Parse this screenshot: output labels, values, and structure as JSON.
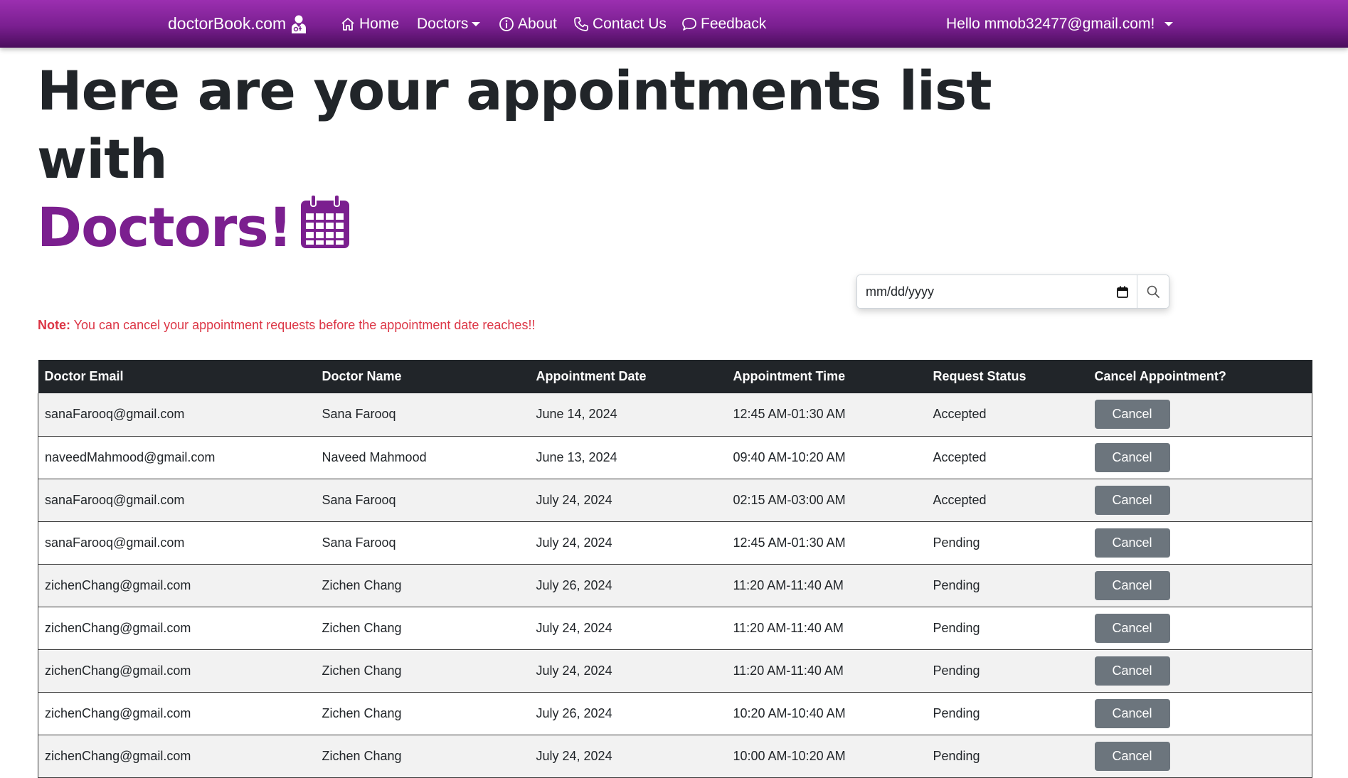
{
  "navbar": {
    "brand": "doctorBook.com",
    "items": [
      {
        "label": "Home",
        "icon": "home-icon"
      },
      {
        "label": "Doctors",
        "icon": null,
        "dropdown": true
      },
      {
        "label": "About",
        "icon": "info-icon"
      },
      {
        "label": "Contact Us",
        "icon": "phone-icon"
      },
      {
        "label": "Feedback",
        "icon": "chat-bubble-icon"
      }
    ],
    "user_greeting": "Hello mmob32477@gmail.com!"
  },
  "heading": {
    "line1": "Here are your appointments list",
    "line2": "with",
    "line3": "Doctors!"
  },
  "date_filter": {
    "placeholder": "mm/dd/yyyy"
  },
  "note": {
    "label": "Note:",
    "text": " You can cancel your appointment requests before the appointment date reaches!!"
  },
  "table": {
    "headers": [
      "Doctor Email",
      "Doctor Name",
      "Appointment Date",
      "Appointment Time",
      "Request Status",
      "Cancel Appointment?"
    ],
    "cancel_label": "Cancel",
    "rows": [
      {
        "email": "sanaFarooq@gmail.com",
        "name": "Sana Farooq",
        "date": "June 14, 2024",
        "time": "12:45 AM-01:30 AM",
        "status": "Accepted"
      },
      {
        "email": "naveedMahmood@gmail.com",
        "name": "Naveed Mahmood",
        "date": "June 13, 2024",
        "time": "09:40 AM-10:20 AM",
        "status": "Accepted"
      },
      {
        "email": "sanaFarooq@gmail.com",
        "name": "Sana Farooq",
        "date": "July 24, 2024",
        "time": "02:15 AM-03:00 AM",
        "status": "Accepted"
      },
      {
        "email": "sanaFarooq@gmail.com",
        "name": "Sana Farooq",
        "date": "July 24, 2024",
        "time": "12:45 AM-01:30 AM",
        "status": "Pending"
      },
      {
        "email": "zichenChang@gmail.com",
        "name": "Zichen Chang",
        "date": "July 26, 2024",
        "time": "11:20 AM-11:40 AM",
        "status": "Pending"
      },
      {
        "email": "zichenChang@gmail.com",
        "name": "Zichen Chang",
        "date": "July 24, 2024",
        "time": "11:20 AM-11:40 AM",
        "status": "Pending"
      },
      {
        "email": "zichenChang@gmail.com",
        "name": "Zichen Chang",
        "date": "July 24, 2024",
        "time": "11:20 AM-11:40 AM",
        "status": "Pending"
      },
      {
        "email": "zichenChang@gmail.com",
        "name": "Zichen Chang",
        "date": "July 26, 2024",
        "time": "10:20 AM-10:40 AM",
        "status": "Pending"
      },
      {
        "email": "zichenChang@gmail.com",
        "name": "Zichen Chang",
        "date": "July 24, 2024",
        "time": "10:00 AM-10:20 AM",
        "status": "Pending"
      }
    ]
  },
  "colors": {
    "nav_gradient_top": "#9b2fb0",
    "nav_gradient_bottom": "#4a0d5c",
    "accent_purple": "#7b1f8f",
    "note_red": "#dc3545",
    "table_header_bg": "#212529",
    "cancel_button_bg": "#6c757d"
  }
}
